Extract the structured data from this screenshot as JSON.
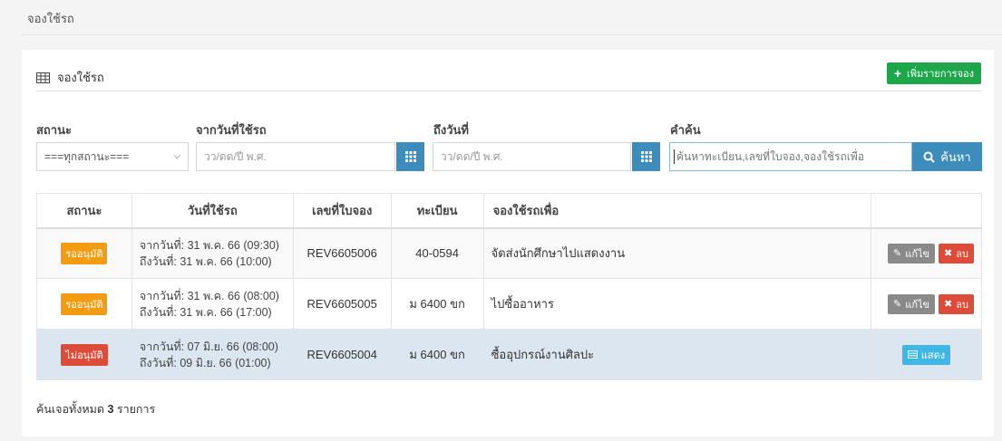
{
  "page": {
    "title": "จองใช้รถ"
  },
  "card": {
    "title": "จองใช้รถ",
    "add_button": "เพิ่มรายการจอง"
  },
  "filters": {
    "status_label": "สถานะ",
    "status_value": "===ทุกสถานะ===",
    "from_label": "จากวันที่ใช้รถ",
    "from_placeholder": "วว/ดด/ปี พ.ศ.",
    "to_label": "ถึงวันที่",
    "to_placeholder": "วว/ดด/ปี พ.ศ.",
    "keyword_label": "คำค้น",
    "keyword_placeholder": "ค้นหาทะเบียน,เลขที่ใบจอง,จองใช้รถเพื่อ",
    "search_button": "ค้นหา"
  },
  "table": {
    "headers": [
      "สถานะ",
      "วันที่ใช้รถ",
      "เลขที่ใบจอง",
      "ทะเบียน",
      "จองใช้รถเพื่อ",
      ""
    ],
    "rows": [
      {
        "status": "รออนุมัติ",
        "from": "จากวันที่: 31 พ.ค. 66 (09:30)",
        "to": "ถึงวันที่: 31 พ.ค. 66 (10:00)",
        "booking_no": "REV6605006",
        "plate": "40-0594",
        "purpose": "จัดส่งนักศึกษาไปแสดงงาน",
        "edit": "แก้ไข",
        "delete": "ลบ"
      },
      {
        "status": "รออนุมัติ",
        "from": "จากวันที่: 31 พ.ค. 66 (08:00)",
        "to": "ถึงวันที่: 31 พ.ค. 66 (17:00)",
        "booking_no": "REV6605005",
        "plate": "ม 6400 ขก",
        "purpose": "ไปซื้ออาหาร",
        "edit": "แก้ไข",
        "delete": "ลบ"
      },
      {
        "status": "ไม่อนุมัติ",
        "from": "จากวันที่: 07 มิ.ย. 66 (08:00)",
        "to": "ถึงวันที่: 09 มิ.ย. 66 (01:00)",
        "booking_no": "REV6605004",
        "plate": "ม 6400 ขก",
        "purpose": "ซื้ออุปกรณ์งานศิลปะ",
        "show": "แสดง"
      }
    ]
  },
  "footer": {
    "prefix": "ค้นเจอทั้งหมด",
    "count": "3",
    "suffix": "รายการ"
  },
  "colors": {
    "primary": "#3c8dbc",
    "success": "#1ea74a",
    "warning": "#f39c12",
    "danger": "#dd4b39",
    "info": "#3fb7e6",
    "edit": "#8a8a8a"
  }
}
